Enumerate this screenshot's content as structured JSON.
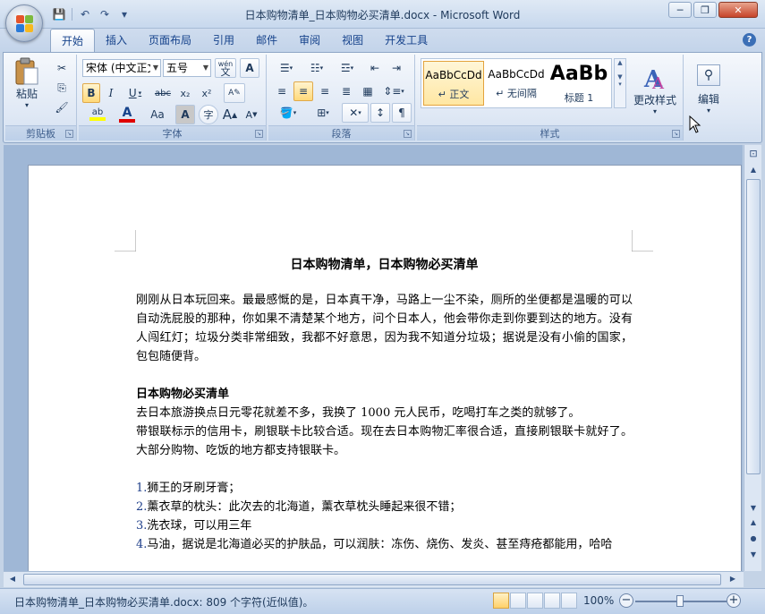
{
  "window": {
    "title": "日本购物清单_日本购物必买清单.docx - Microsoft Word",
    "minimize_glyph": "─",
    "restore_glyph": "❐",
    "close_glyph": "✕"
  },
  "qat": {
    "save": "💾",
    "undo": "↶",
    "redo": "↷",
    "more": "▾"
  },
  "ribbon_tabs": [
    "开始",
    "插入",
    "页面布局",
    "引用",
    "邮件",
    "审阅",
    "视图",
    "开发工具"
  ],
  "active_tab": "开始",
  "help_glyph": "?",
  "clipboard": {
    "group_label": "剪贴板",
    "paste_label": "粘贴",
    "paste_arrow": "▾"
  },
  "font": {
    "group_label": "字体",
    "font_name": "宋体 (中文正文)",
    "font_size": "五号",
    "phonetic_label": "wén",
    "bold": "B",
    "italic": "I",
    "underline": "U",
    "strike": "abc",
    "subscript": "x₂",
    "superscript": "x²",
    "highlight": "ab",
    "font_color": "A",
    "change_case": "Aa",
    "char_shading": "A",
    "enclose": "字",
    "grow": "A",
    "shrink": "A",
    "border_char": "A"
  },
  "paragraph": {
    "group_label": "段落"
  },
  "styles": {
    "group_label": "样式",
    "items": [
      {
        "sample": "AaBbCcDd",
        "name": "↵ 正文"
      },
      {
        "sample": "AaBbCcDd",
        "name": "↵ 无间隔"
      },
      {
        "sample": "AaBb",
        "name": "标题 1"
      }
    ],
    "change_styles_label": "更改样式",
    "change_styles_arrow": "▾"
  },
  "editing": {
    "label": "编辑",
    "arrow": "▾"
  },
  "document": {
    "title": "日本购物清单，日本购物必买清单",
    "intro": "刚刚从日本玩回来。最最感慨的是，日本真干净，马路上一尘不染，厕所的坐便都是温暖的可以自动洗屁股的那种，你如果不清楚某个地方，问个日本人，他会带你走到你要到达的地方。没有人闯红灯；垃圾分类非常细致，我都不好意思，因为我不知道分垃圾；据说是没有小偷的国家，包包随便背。",
    "subheading": "日本购物必买清单",
    "line1": "去日本旅游换点日元零花就差不多，我换了 1000 元人民币，吃喝打车之类的就够了。",
    "line2": "带银联标示的信用卡，刷银联卡比较合适。现在去日本购物汇率很合适，直接刷银联卡就好了。大部分购物、吃饭的地方都支持银联卡。",
    "items": [
      {
        "num": "1.",
        "text": "狮王的牙刷牙膏；"
      },
      {
        "num": "2.",
        "text": "薰衣草的枕头：此次去的北海道，薰衣草枕头睡起来很不错；"
      },
      {
        "num": "3.",
        "text": "洗衣球，可以用三年"
      },
      {
        "num": "4.",
        "text": "马油，据说是北海道必买的护肤品，可以润肤：冻伤、烧伤、发炎、甚至痔疮都能用，哈哈"
      }
    ]
  },
  "statusbar": {
    "text": "日本购物清单_日本购物必买清单.docx: 809 个字符(近似值)。",
    "zoom": "100%",
    "zoom_minus": "−",
    "zoom_plus": "+"
  },
  "scroll": {
    "up": "▲",
    "down": "▼",
    "left": "◀",
    "right": "▶"
  },
  "colors": {
    "accent": "#15428b",
    "font_color_bar": "#e00000",
    "highlight_bar": "#ffff00"
  }
}
